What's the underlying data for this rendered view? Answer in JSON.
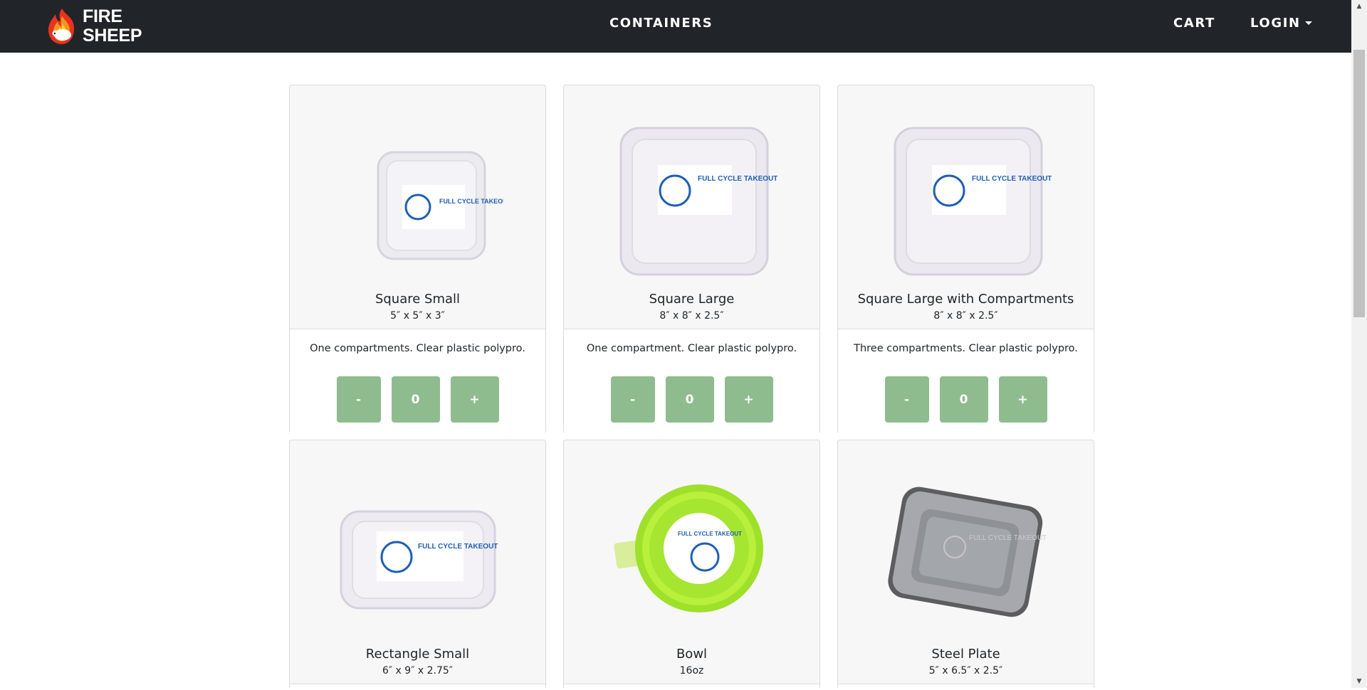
{
  "nav": {
    "brand_line1": "FIRE",
    "brand_line2": "SHEEP",
    "containers": "CONTAINERS",
    "cart": "CART",
    "login": "LOGIN"
  },
  "products": [
    {
      "name": "Square Small",
      "dims": "5″ x 5″ x 3″",
      "desc": "One compartments. Clear plastic polypro.",
      "minus": "-",
      "count": "0",
      "plus": "+",
      "image": "clear-square-small-container",
      "label_text": "FULL CYCLE TAKEOUT"
    },
    {
      "name": "Square Large",
      "dims": "8″ x 8″ x 2.5″",
      "desc": "One compartment. Clear plastic polypro.",
      "minus": "-",
      "count": "0",
      "plus": "+",
      "image": "clear-square-large-container",
      "label_text": "FULL CYCLE TAKEOUT"
    },
    {
      "name": "Square Large with Compartments",
      "dims": "8″ x 8″ x 2.5″",
      "desc": "Three compartments. Clear plastic polypro.",
      "minus": "-",
      "count": "0",
      "plus": "+",
      "image": "clear-square-compartment-container",
      "label_text": "FULL CYCLE TAKEOUT"
    },
    {
      "name": "Rectangle Small",
      "dims": "6″ x 9″ x 2.75″",
      "image": "clear-rectangle-small-container",
      "label_text": "FULL CYCLE TAKEOUT"
    },
    {
      "name": "Bowl",
      "dims": "16oz",
      "image": "green-bowl-container",
      "label_text": "FULL CYCLE TAKEOUT"
    },
    {
      "name": "Steel Plate",
      "dims": "5″ x 6.5″ x 2.5″",
      "image": "steel-plate-container",
      "label_text": "FULL CYCLE TAKEOUT"
    }
  ],
  "colors": {
    "navbar": "#212529",
    "button_green": "#8fbc8f",
    "card_bg": "#f7f7f7"
  }
}
